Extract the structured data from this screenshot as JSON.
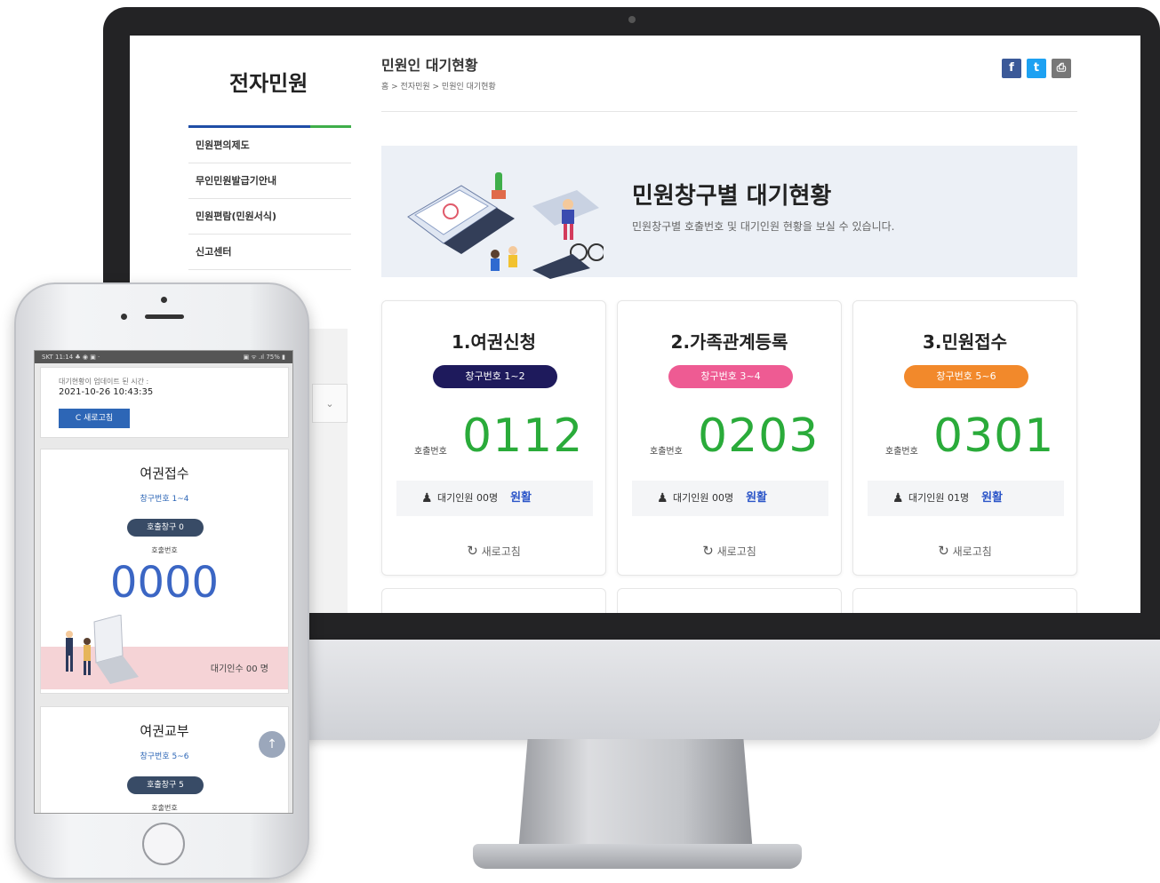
{
  "site": {
    "brand": "전자민원"
  },
  "nav": {
    "items": [
      "민원편의제도",
      "무인민원발급기안내",
      "민원편람(민원서식)",
      "신고센터"
    ]
  },
  "header": {
    "title": "민원인 대기현황",
    "breadcrumb": "홈 > 전자민원 > 민원인 대기현황"
  },
  "social": [
    {
      "label": "f",
      "name": "facebook-icon",
      "color": "#3b5998"
    },
    {
      "label": "t",
      "name": "twitter-icon",
      "color": "#1da1f2"
    },
    {
      "label": "⎙",
      "name": "print-icon",
      "color": "#777777"
    }
  ],
  "banner": {
    "title": "민원창구별 대기현황",
    "subtitle": "민원창구별 호출번호 및 대기인원 현황을 보실 수 있습니다."
  },
  "cards": [
    {
      "title": "1.여권신청",
      "window": "창구번호 1~2",
      "badge_color": "#1e1a5c",
      "label": "호출번호",
      "number": "0112",
      "wait": "대기인원 00명",
      "status": "원활",
      "refresh": "새로고침"
    },
    {
      "title": "2.가족관계등록",
      "window": "창구번호 3~4",
      "badge_color": "#ee5b93",
      "label": "호출번호",
      "number": "0203",
      "wait": "대기인원 00명",
      "status": "원활",
      "refresh": "새로고침"
    },
    {
      "title": "3.민원접수",
      "window": "창구번호 5~6",
      "badge_color": "#f2892b",
      "label": "호출번호",
      "number": "0301",
      "wait": "대기인원 01명",
      "status": "원활",
      "refresh": "새로고침"
    }
  ],
  "phone": {
    "status_left": "SKT 11:14 ♣ ◉ ▣ ·",
    "status_right": "▣ ᯤ .ıl 75% ▮",
    "update_label": "대기현황이 업데이트 된 시간 :",
    "update_time": "2021-10-26 10:43:35",
    "refresh": "C 새로고침",
    "cards": [
      {
        "title": "여권접수",
        "window": "창구번호 1~4",
        "call": "호출창구 0",
        "label": "호출번호",
        "number": "0000",
        "wait": "대기인수 00 명"
      },
      {
        "title": "여권교부",
        "window": "창구번호 5~6",
        "call": "호출창구 5",
        "label": "호출번호"
      }
    ]
  }
}
